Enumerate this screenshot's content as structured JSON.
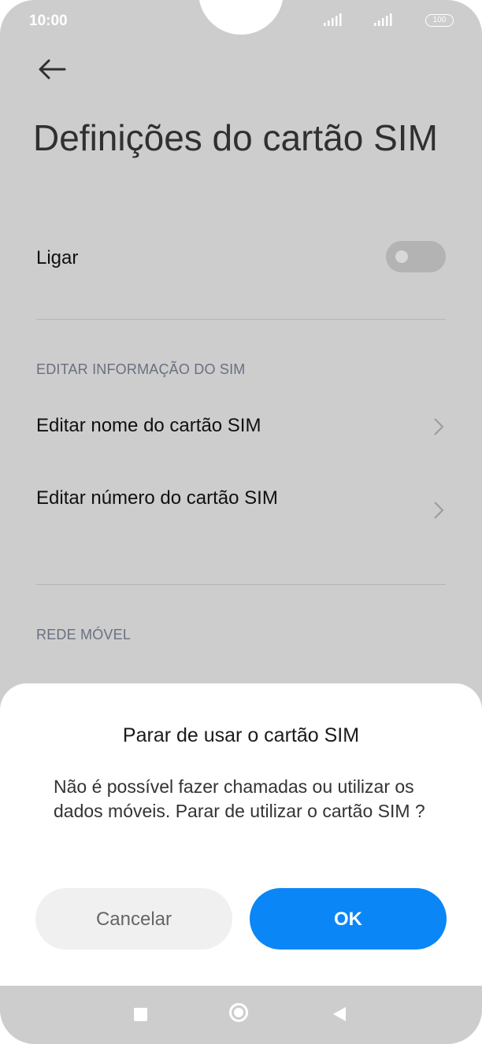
{
  "status_bar": {
    "time": "10:00",
    "battery": "100"
  },
  "page": {
    "title": "Definições do cartão SIM",
    "power_row": {
      "label": "Ligar",
      "enabled": false
    }
  },
  "sections": [
    {
      "header": "EDITAR INFORMAÇÃO DO SIM",
      "items": [
        {
          "label": "Editar nome do cartão SIM"
        },
        {
          "label": "Editar número do cartão SIM"
        }
      ]
    },
    {
      "header": "REDE MÓVEL"
    }
  ],
  "dialog": {
    "title": "Parar de usar o cartão SIM",
    "message": "Não é possível fazer chamadas ou utilizar os dados móveis. Parar de utilizar o cartão SIM        ?",
    "cancel_label": "Cancelar",
    "ok_label": "OK"
  },
  "icons": {
    "back": "arrow-left-icon",
    "chevron": "chevron-right-icon",
    "nav_recent": "square-icon",
    "nav_home": "circle-icon",
    "nav_back": "triangle-left-icon"
  },
  "colors": {
    "dim_background": "#cdcdcd",
    "sheet": "#ffffff",
    "ok_button": "#0a86f6",
    "cancel_button": "#f0f0f0"
  }
}
